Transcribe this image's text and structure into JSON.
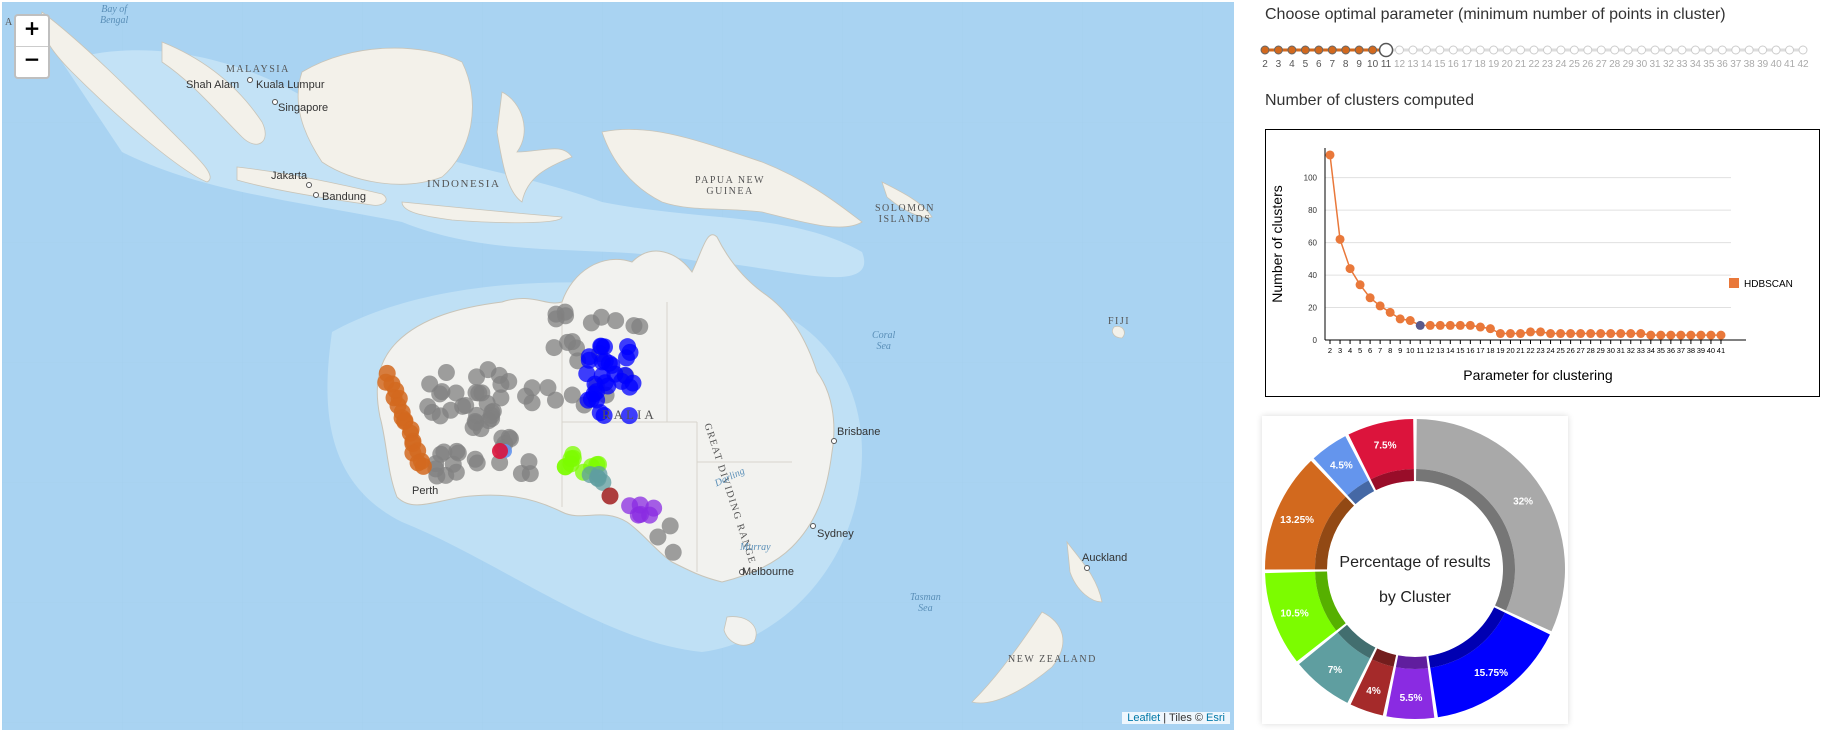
{
  "map": {
    "zoom_in": "+",
    "zoom_out": "−",
    "attribution": {
      "leaflet": "Leaflet",
      "sep": " | Tiles © ",
      "esri": "Esri"
    },
    "labels": {
      "malaysia": "MALAYSIA",
      "indonesia": "INDONESIA",
      "papua": "PAPUA NEW",
      "guinea": "GUINEA",
      "solomon": "SOLOMON",
      "islands": "ISLANDS",
      "australia": "RALIA",
      "fiji": "FIJI",
      "new_zealand": "NEW ZEALAND",
      "great_dividing": "GREAT DIVIDING RANGE"
    },
    "cities": {
      "shah_alam": "Shah Alam",
      "kuala_lumpur": "Kuala Lumpur",
      "singapore": "Singapore",
      "jakarta": "Jakarta",
      "bandung": "Bandung",
      "brisbane": "Brisbane",
      "sydney": "Sydney",
      "melbourne": "Melbourne",
      "auckland": "Auckland",
      "perth": "Perth"
    },
    "water": {
      "bay_of_bengal_1": "Bay of",
      "bay_of_bengal_2": "Bengal",
      "coral_1": "Coral",
      "coral_2": "Sea",
      "tasman_1": "Tasman",
      "tasman_2": "Sea",
      "darling": "Darling",
      "murray": "Murray"
    },
    "cluster_colors": {
      "noise": "#808080",
      "orange": "#d2691e",
      "blue": "#0000ff",
      "green": "#7cfc00",
      "teal": "#5f9ea0",
      "purple": "#8a2be2",
      "darkred": "#a52a2a",
      "crimson": "#dc143c",
      "cornflower": "#6495ed"
    }
  },
  "slider": {
    "title": "Choose optimal parameter (minimum number of points in cluster)",
    "ticks": [
      "2",
      "3",
      "4",
      "5",
      "6",
      "7",
      "8",
      "9",
      "10",
      "11",
      "12",
      "13",
      "14",
      "15",
      "16",
      "17",
      "18",
      "19",
      "20",
      "21",
      "22",
      "23",
      "24",
      "25",
      "26",
      "27",
      "28",
      "29",
      "30",
      "31",
      "32",
      "33",
      "34",
      "35",
      "36",
      "37",
      "38",
      "39",
      "40",
      "41",
      "42"
    ],
    "selected": "11",
    "active_color": "#d2691e"
  },
  "clusters_title": "Number of clusters computed",
  "chart_data": [
    {
      "type": "line",
      "xlabel": "Parameter for clustering",
      "ylabel": "Number of clusters",
      "ylim": [
        0,
        110
      ],
      "yticks": [
        "0",
        "20",
        "40",
        "60",
        "80",
        "100"
      ],
      "legend": "right",
      "series": [
        {
          "name": "HDBSCAN",
          "color": "#e9783a",
          "x": [
            2,
            3,
            4,
            5,
            6,
            7,
            8,
            9,
            10,
            11,
            12,
            13,
            14,
            15,
            16,
            17,
            18,
            19,
            20,
            21,
            22,
            23,
            24,
            25,
            26,
            27,
            28,
            29,
            30,
            31,
            32,
            33,
            34,
            35,
            36,
            37,
            38,
            39,
            40,
            41
          ],
          "values": [
            114,
            62,
            44,
            34,
            26,
            21,
            17,
            13,
            12,
            9,
            9,
            9,
            9,
            9,
            9,
            8,
            7,
            4,
            4,
            4,
            5,
            5,
            4,
            4,
            4,
            4,
            4,
            4,
            4,
            4,
            4,
            4,
            3,
            3,
            3,
            3,
            3,
            3,
            3,
            3
          ]
        }
      ],
      "highlight": {
        "x": 11,
        "color": "#5a5a8c"
      }
    },
    {
      "type": "pie",
      "title_line1": "Percentage of results",
      "title_line2": "by Cluster",
      "labels": [
        "32%",
        "15.75%",
        "5.5%",
        "4%",
        "7%",
        "10.5%",
        "13.25%",
        "4.5%",
        "7.5%"
      ],
      "values": [
        32,
        15.75,
        5.5,
        4,
        7,
        10.5,
        13.25,
        4.5,
        7.5
      ],
      "colors": [
        "#a9a9a9",
        "#0000ff",
        "#8a2be2",
        "#a52a2a",
        "#5f9ea0",
        "#7cfc00",
        "#d2691e",
        "#6495ed",
        "#dc143c"
      ]
    }
  ]
}
